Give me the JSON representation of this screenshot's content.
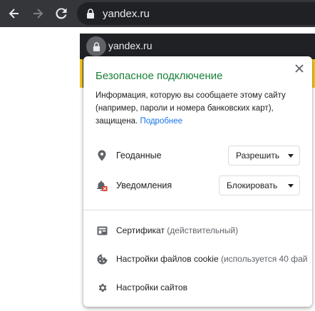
{
  "browser": {
    "url": "yandex.ru"
  },
  "background_window": {
    "url": "yandex.ru"
  },
  "popup": {
    "title": "Безопасное подключение",
    "description": "Информация, которую вы сообщаете этому сайту (например, пароли и номера банковских карт), защищена.",
    "more_link": "Подробнее",
    "permissions": [
      {
        "label": "Геоданные",
        "value": "Разрешить",
        "icon": "location-pin-icon"
      },
      {
        "label": "Уведомления",
        "value": "Блокировать",
        "icon": "bell-blocked-icon"
      }
    ],
    "links": [
      {
        "label": "Сертификат",
        "sub": "(действительный)",
        "icon": "certificate-icon"
      },
      {
        "label": "Настройки файлов cookie",
        "sub": "(используется 40 фай",
        "icon": "cookie-icon"
      },
      {
        "label": "Настройки сайтов",
        "sub": "",
        "icon": "gear-icon"
      }
    ]
  },
  "colors": {
    "toolbar": "#35363a",
    "omnibox": "#202124",
    "secure_title": "#188038",
    "link": "#1a73e8",
    "blocked_badge": "#d93025"
  }
}
